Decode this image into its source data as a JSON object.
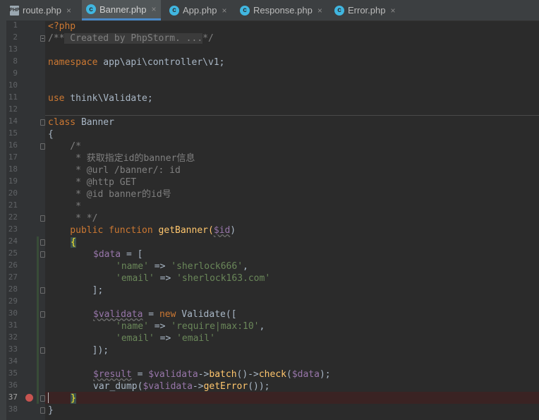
{
  "tabs": [
    {
      "label": "route.php",
      "icon": "php-file-icon",
      "active": false
    },
    {
      "label": "Banner.php",
      "icon": "class-icon",
      "active": true
    },
    {
      "label": "App.php",
      "icon": "class-icon",
      "active": false
    },
    {
      "label": "Response.php",
      "icon": "class-icon",
      "active": false
    },
    {
      "label": "Error.php",
      "icon": "class-icon",
      "active": false
    }
  ],
  "tab_close_glyph": "×",
  "line_numbers": [
    "1",
    "2",
    "8",
    "9",
    "10",
    "11",
    "12",
    "13",
    "14",
    "15",
    "16",
    "17",
    "18",
    "19",
    "20",
    "21",
    "22",
    "23",
    "24",
    "25",
    "26",
    "27",
    "28",
    "29",
    "30",
    "31",
    "32",
    "33",
    "34",
    "35",
    "36",
    "37",
    "38"
  ],
  "current_line": "37",
  "code": {
    "l1": "<?php",
    "l2_open": "/**",
    "l2_fold": " Created by PhpStorm. ...",
    "l2_close": "*/",
    "l9_kw": "namespace",
    "l9_ns": " app\\api\\controller\\v1;",
    "l12_kw": "use",
    "l12_ns": " think\\Validate;",
    "l14_kw": "class",
    "l14_name": " Banner",
    "l15": "{",
    "l16": "    /*",
    "l17": "     * 获取指定id的banner信息",
    "l18": "     * @url /banner/: id",
    "l19": "     * @http GET",
    "l20": "     * @id banner的id号",
    "l21": "     *",
    "l22": "     * */",
    "l23_kw": "    public function",
    "l23_fn": " getBanner(",
    "l23_var": "$id",
    "l23_end": ")",
    "l24": "{",
    "l25_var": "$data",
    "l25_rest": " = [",
    "l26_k": "'name'",
    "l26_op": " => ",
    "l26_v": "'sherlock666'",
    "l26_c": ",",
    "l27_k": "'email'",
    "l27_op": " => ",
    "l27_v": "'sherlock163.com'",
    "l28": "        ];",
    "l30_var": "$validata",
    "l30_op": " = ",
    "l30_new": "new",
    "l30_rest": " Validate([",
    "l31_k": "'name'",
    "l31_op": " => ",
    "l31_v": "'require|max:10'",
    "l31_c": ",",
    "l32_k": "'email'",
    "l32_op": " => ",
    "l32_v": "'email'",
    "l33": "        ]);",
    "l35_var": "$result",
    "l35_op": " = ",
    "l35_var2": "$validata",
    "l35_arrow": "->",
    "l35_fn1": "batch",
    "l35_mid": "()->",
    "l35_fn2": "check",
    "l35_p": "(",
    "l35_var3": "$data",
    "l35_end": ");",
    "l36_fn": "var_dump(",
    "l36_var": "$validata",
    "l36_arrow": "->",
    "l36_fn2": "getError",
    "l36_end": "());",
    "l37": "}",
    "l38": "}"
  },
  "colors": {
    "keyword": "#cc7832",
    "string": "#6a8759",
    "variable": "#9876aa",
    "comment": "#808080",
    "function": "#ffc66d",
    "default": "#a9b7c6",
    "breakpoint": "#c75450",
    "tab_accent": "#4a88c7"
  }
}
